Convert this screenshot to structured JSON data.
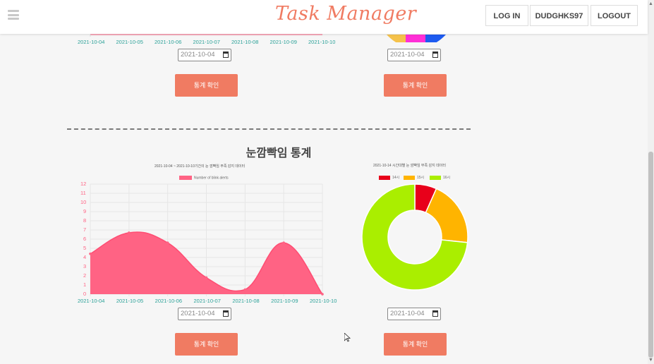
{
  "header": {
    "brand": "Task Manager",
    "login": "LOG IN",
    "user": "DUDGHKS97",
    "logout": "LOGOUT"
  },
  "top_section": {
    "line_chart_x_labels": [
      "2021-10-04",
      "2021-10-05",
      "2021-10-06",
      "2021-10-07",
      "2021-10-08",
      "2021-10-09",
      "2021-10-10"
    ],
    "date_left": "2021-10-04",
    "date_right": "2021-10-04",
    "button_left": "통계 확인",
    "button_right": "통계 확인"
  },
  "blink_section": {
    "title": "눈깜빡임 통계",
    "date_left": "2021-10-04",
    "date_right": "2021-10-04",
    "button_left": "통계 확인",
    "button_right": "통계 확인"
  },
  "colors": {
    "accent": "#f07b62",
    "line_fill": "#ff6384",
    "slice_14": "#e8001a",
    "slice_15": "#ffb400",
    "slice_16": "#aaee00"
  },
  "chart_data": [
    {
      "type": "area",
      "title": "2021-10-04 ~ 2021-10-10기간의 눈 깜빡임 부족 감지 데이터",
      "x": [
        "2021-10-04",
        "2021-10-05",
        "2021-10-06",
        "2021-10-07",
        "2021-10-08",
        "2021-10-09",
        "2021-10-10"
      ],
      "series": [
        {
          "name": "Number of blink alerts",
          "values": [
            4.4,
            6.7,
            5.6,
            1.8,
            0.5,
            5.6,
            0
          ]
        }
      ],
      "y_ticks": [
        0,
        1,
        2,
        3,
        4,
        5,
        6,
        7,
        8,
        9,
        10,
        11,
        12
      ],
      "ylim": [
        0,
        12
      ],
      "grid": true,
      "legend": "top"
    },
    {
      "type": "pie",
      "title": "2021-10-14 시간대별 눈 깜빡임 부족 감지 데이터",
      "categories": [
        "14시",
        "15시",
        "16시"
      ],
      "values": [
        1,
        3,
        11
      ],
      "legend": "top",
      "donut": true
    }
  ]
}
